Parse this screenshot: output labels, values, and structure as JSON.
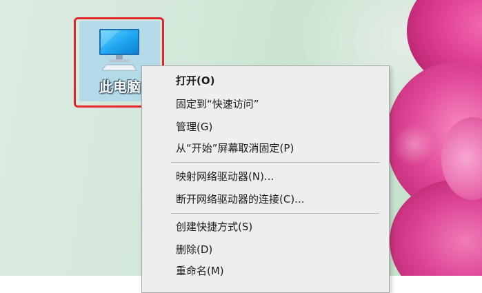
{
  "desktop": {
    "icon_label": "此电脑",
    "icon_name": "computer-monitor-icon",
    "highlight_color": "#e0262a"
  },
  "context_menu": {
    "items": [
      {
        "label": "打开(O)",
        "bold": true
      },
      {
        "label": "固定到“快速访问”"
      },
      {
        "label": "管理(G)"
      },
      {
        "label": "从“开始”屏幕取消固定(P)"
      },
      {
        "label": "映射网络驱动器(N)..."
      },
      {
        "label": "断开网络驱动器的连接(C)..."
      },
      {
        "label": "创建快捷方式(S)"
      },
      {
        "label": "删除(D)"
      },
      {
        "label": "重命名(M)"
      }
    ]
  }
}
